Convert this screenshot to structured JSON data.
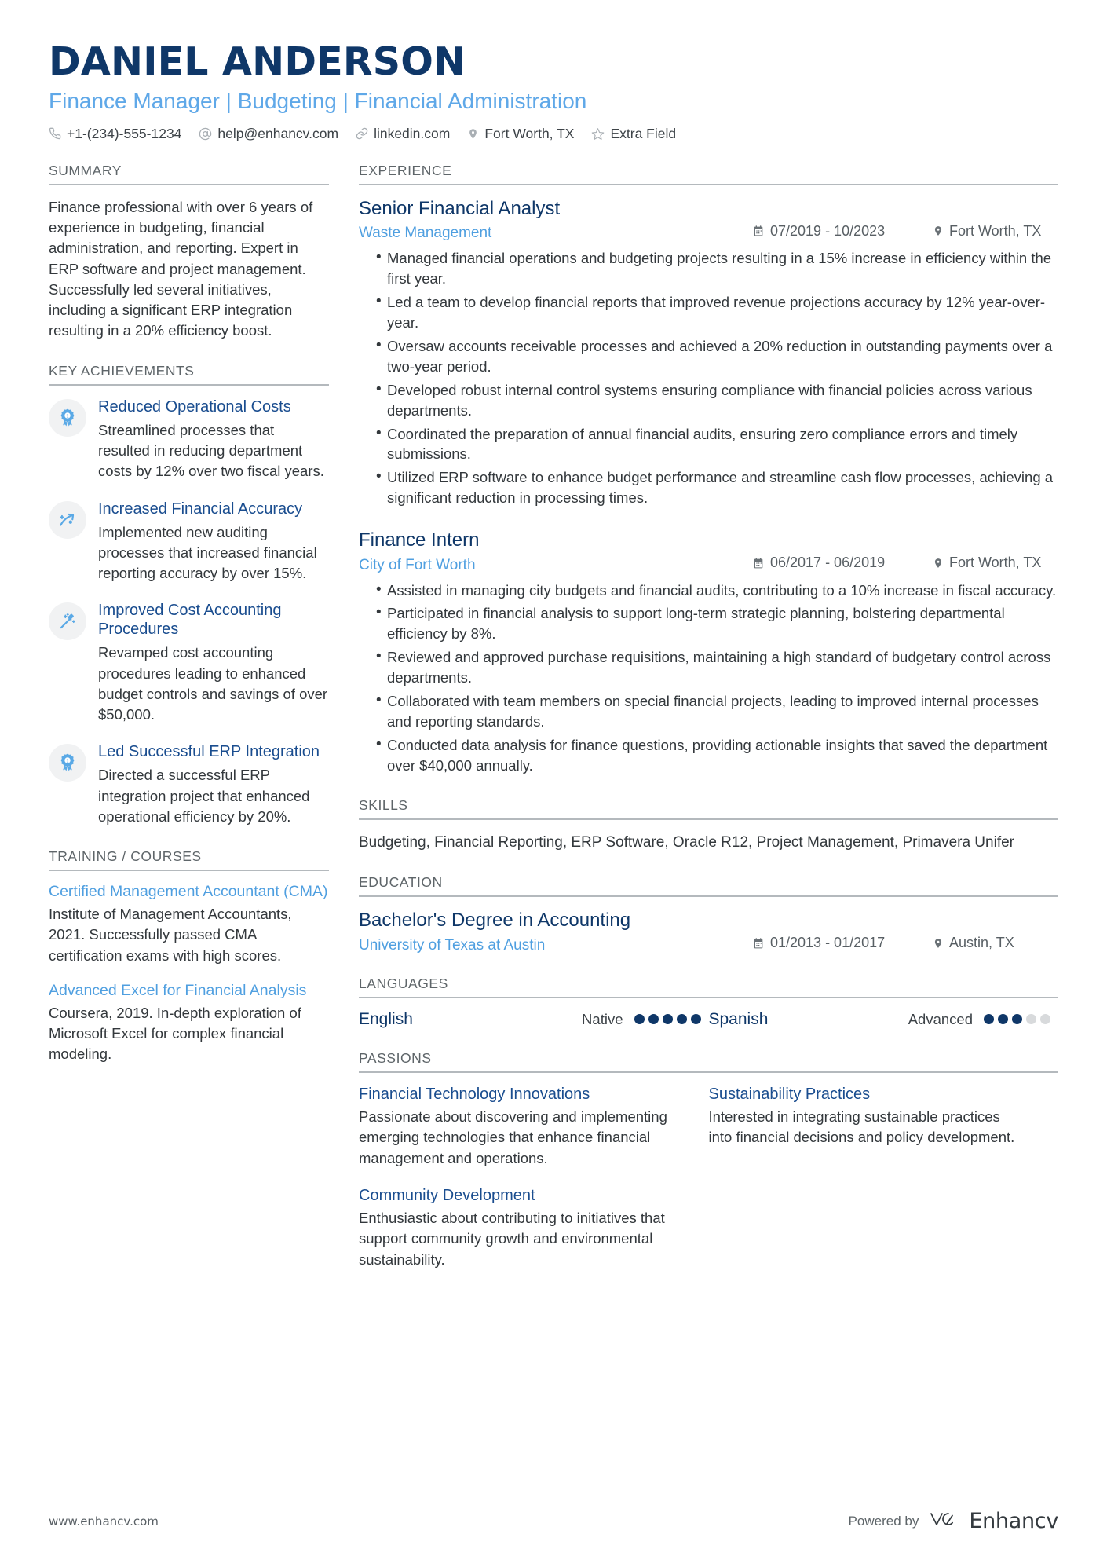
{
  "header": {
    "name": "DANIEL ANDERSON",
    "headline": "Finance Manager | Budgeting | Financial Administration",
    "contacts": [
      {
        "icon": "phone-icon",
        "text": "+1-(234)-555-1234"
      },
      {
        "icon": "email-icon",
        "text": "help@enhancv.com"
      },
      {
        "icon": "link-icon",
        "text": "linkedin.com"
      },
      {
        "icon": "location-pin-icon",
        "text": "Fort Worth, TX"
      },
      {
        "icon": "star-icon",
        "text": "Extra Field"
      }
    ]
  },
  "summary": {
    "title": "SUMMARY",
    "text": "Finance professional with over 6 years of experience in budgeting, financial administration, and reporting. Expert in ERP software and project management. Successfully led several initiatives, including a significant ERP integration resulting in a 20% efficiency boost."
  },
  "key_achievements": {
    "title": "KEY ACHIEVEMENTS",
    "items": [
      {
        "icon": "award-ribbon-icon",
        "title": "Reduced Operational Costs",
        "desc": "Streamlined processes that resulted in reducing department costs by 12% over two fiscal years."
      },
      {
        "icon": "trending-up-arrow-icon",
        "title": "Increased Financial Accuracy",
        "desc": "Implemented new auditing processes that increased financial reporting accuracy by over 15%."
      },
      {
        "icon": "magic-wand-icon",
        "title": "Improved Cost Accounting Procedures",
        "desc": "Revamped cost accounting procedures leading to enhanced budget controls and savings of over $50,000."
      },
      {
        "icon": "award-ribbon-icon",
        "title": "Led Successful ERP Integration",
        "desc": "Directed a successful ERP integration project that enhanced operational efficiency by 20%."
      }
    ]
  },
  "training": {
    "title": "TRAINING / COURSES",
    "items": [
      {
        "title": "Certified Management Accountant (CMA)",
        "desc": "Institute of Management Accountants, 2021. Successfully passed CMA certification exams with high scores."
      },
      {
        "title": "Advanced Excel for Financial Analysis",
        "desc": "Coursera, 2019. In-depth exploration of Microsoft Excel for complex financial modeling."
      }
    ]
  },
  "experience": {
    "title": "EXPERIENCE",
    "jobs": [
      {
        "role": "Senior Financial Analyst",
        "company": "Waste Management",
        "date": "07/2019 - 10/2023",
        "location": "Fort Worth, TX",
        "bullets": [
          "Managed financial operations and budgeting projects resulting in a 15% increase in efficiency within the first year.",
          "Led a team to develop financial reports that improved revenue projections accuracy by 12% year-over-year.",
          "Oversaw accounts receivable processes and achieved a 20% reduction in outstanding payments over a two-year period.",
          "Developed robust internal control systems ensuring compliance with financial policies across various departments.",
          "Coordinated the preparation of annual financial audits, ensuring zero compliance errors and timely submissions.",
          "Utilized ERP software to enhance budget performance and streamline cash flow processes, achieving a significant reduction in processing times."
        ]
      },
      {
        "role": "Finance Intern",
        "company": "City of Fort Worth",
        "date": "06/2017 - 06/2019",
        "location": "Fort Worth, TX",
        "bullets": [
          "Assisted in managing city budgets and financial audits, contributing to a 10% increase in fiscal accuracy.",
          "Participated in financial analysis to support long-term strategic planning, bolstering departmental efficiency by 8%.",
          "Reviewed and approved purchase requisitions, maintaining a high standard of budgetary control across departments.",
          "Collaborated with team members on special financial projects, leading to improved internal processes and reporting standards.",
          "Conducted data analysis for finance questions, providing actionable insights that saved the department over $40,000 annually."
        ]
      }
    ]
  },
  "skills": {
    "title": "SKILLS",
    "text": "Budgeting, Financial Reporting, ERP Software, Oracle R12, Project Management, Primavera Unifer"
  },
  "education": {
    "title": "EDUCATION",
    "items": [
      {
        "degree": "Bachelor's Degree in Accounting",
        "school": "University of Texas at Austin",
        "date": "01/2013 - 01/2017",
        "location": "Austin, TX"
      }
    ]
  },
  "languages": {
    "title": "LANGUAGES",
    "items": [
      {
        "name": "English",
        "level": "Native",
        "filled": 5,
        "total": 5
      },
      {
        "name": "Spanish",
        "level": "Advanced",
        "filled": 3,
        "total": 5
      }
    ]
  },
  "passions": {
    "title": "PASSIONS",
    "items": [
      {
        "title": "Financial Technology Innovations",
        "desc": "Passionate about discovering and implementing emerging technologies that enhance financial management and operations."
      },
      {
        "title": "Sustainability Practices",
        "desc": "Interested in integrating sustainable practices into financial decisions and policy development."
      },
      {
        "title": "Community Development",
        "desc": "Enthusiastic about contributing to initiatives that support community growth and environmental sustainability."
      }
    ]
  },
  "footer": {
    "url": "www.enhancv.com",
    "powered_by": "Powered by",
    "brand": "Enhancv"
  },
  "colors": {
    "navy": "#0f3768",
    "accent_blue": "#4f9fe0",
    "light_blue": "#5fa8e8",
    "text": "#33383c",
    "muted": "#5e6569",
    "rule": "#b4b9bd"
  }
}
